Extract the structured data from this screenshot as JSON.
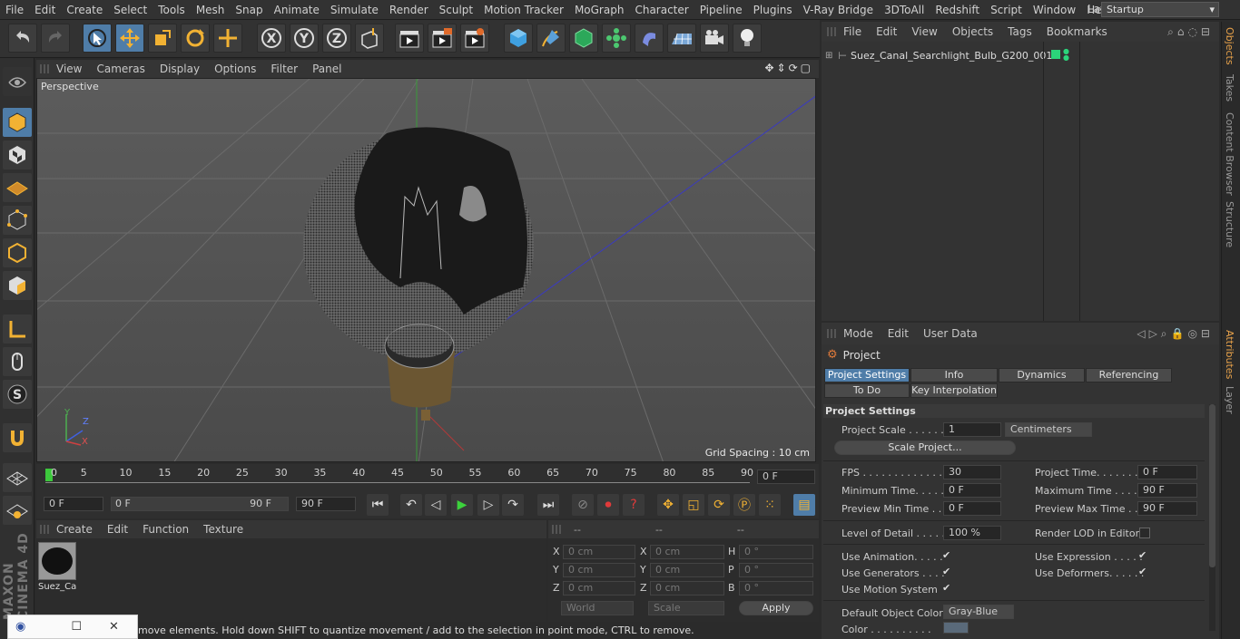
{
  "menubar": {
    "items": [
      "File",
      "Edit",
      "Create",
      "Select",
      "Tools",
      "Mesh",
      "Snap",
      "Animate",
      "Simulate",
      "Render",
      "Sculpt",
      "Motion Tracker",
      "MoGraph",
      "Character",
      "Pipeline",
      "Plugins",
      "V-Ray Bridge",
      "3DToAll",
      "Redshift",
      "Script",
      "Window",
      "Help"
    ],
    "layout_label": "Layout:",
    "layout_value": "Startup"
  },
  "viewport": {
    "menu": [
      "View",
      "Cameras",
      "Display",
      "Options",
      "Filter",
      "Panel"
    ],
    "camera": "Perspective",
    "grid_spacing": "Grid Spacing : 10 cm",
    "axis_x": "X",
    "axis_y": "Y",
    "axis_z": "Z"
  },
  "timeline": {
    "ticks": [
      "0",
      "5",
      "10",
      "15",
      "20",
      "25",
      "30",
      "35",
      "40",
      "45",
      "50",
      "55",
      "60",
      "65",
      "70",
      "75",
      "80",
      "85",
      "90"
    ],
    "current_frame": "0 F"
  },
  "transport": {
    "start_field": "0 F",
    "range_start": "0 F",
    "range_end": "90 F",
    "end_field": "90 F"
  },
  "material_manager": {
    "menu": [
      "Create",
      "Edit",
      "Function",
      "Texture"
    ],
    "material_name": "Suez_Ca"
  },
  "coordinates": {
    "header": [
      "--",
      "--",
      "--"
    ],
    "rows": [
      {
        "a": "X",
        "av": "0 cm",
        "b": "X",
        "bv": "0 cm",
        "c": "H",
        "cv": "0 °"
      },
      {
        "a": "Y",
        "av": "0 cm",
        "b": "Y",
        "bv": "0 cm",
        "c": "P",
        "cv": "0 °"
      },
      {
        "a": "Z",
        "av": "0 cm",
        "b": "Z",
        "bv": "0 cm",
        "c": "B",
        "cv": "0 °"
      }
    ],
    "mode": "World",
    "scale": "Scale",
    "apply": "Apply"
  },
  "status": {
    "text": "move elements. Hold down SHIFT to quantize movement / add to the selection in point mode, CTRL to remove."
  },
  "object_manager": {
    "menu": [
      "File",
      "Edit",
      "View",
      "Objects",
      "Tags",
      "Bookmarks"
    ],
    "object_name": "Suez_Canal_Searchlight_Bulb_G200_001"
  },
  "attributes": {
    "menu": [
      "Mode",
      "Edit",
      "User Data"
    ],
    "title": "Project",
    "tabs": [
      "Project Settings",
      "Info",
      "Dynamics",
      "Referencing"
    ],
    "tabs2": [
      "To Do",
      "Key Interpolation"
    ],
    "section": "Project Settings",
    "project_scale_label": "Project Scale . . . . . .",
    "project_scale_value": "1",
    "project_scale_unit": "Centimeters",
    "scale_project_btn": "Scale Project...",
    "fps_label": "FPS . . . . . . . . . . . . . .",
    "fps_value": "30",
    "project_time_label": "Project Time. . . . . . . .",
    "project_time_value": "0 F",
    "min_time_label": "Minimum Time. . . . . .",
    "min_time_value": "0 F",
    "max_time_label": "Maximum Time . . . . .",
    "max_time_value": "90 F",
    "preview_min_label": "Preview Min Time . .",
    "preview_min_value": "0 F",
    "preview_max_label": "Preview Max Time . . .",
    "preview_max_value": "90 F",
    "lod_label": "Level of Detail . . . . .",
    "lod_value": "100 %",
    "render_lod_label": "Render LOD in Editor",
    "use_animation_label": "Use Animation. . . . .",
    "use_expression_label": "Use Expression . . . . .",
    "use_generators_label": "Use Generators . . . .",
    "use_deformers_label": "Use Deformers. . . . . .",
    "use_motion_label": "Use Motion System",
    "default_color_label": "Default Object Color",
    "default_color_value": "Gray-Blue",
    "color_label": "Color . . . . . . . . . ."
  },
  "right_tabs": [
    "Objects",
    "Takes",
    "Content Browser",
    "Structure",
    "Attributes",
    "Layer"
  ],
  "branding": "MAXON CINEMA 4D",
  "colors": {
    "accent": "#4f7da8",
    "tag_green": "#2bd47a"
  }
}
